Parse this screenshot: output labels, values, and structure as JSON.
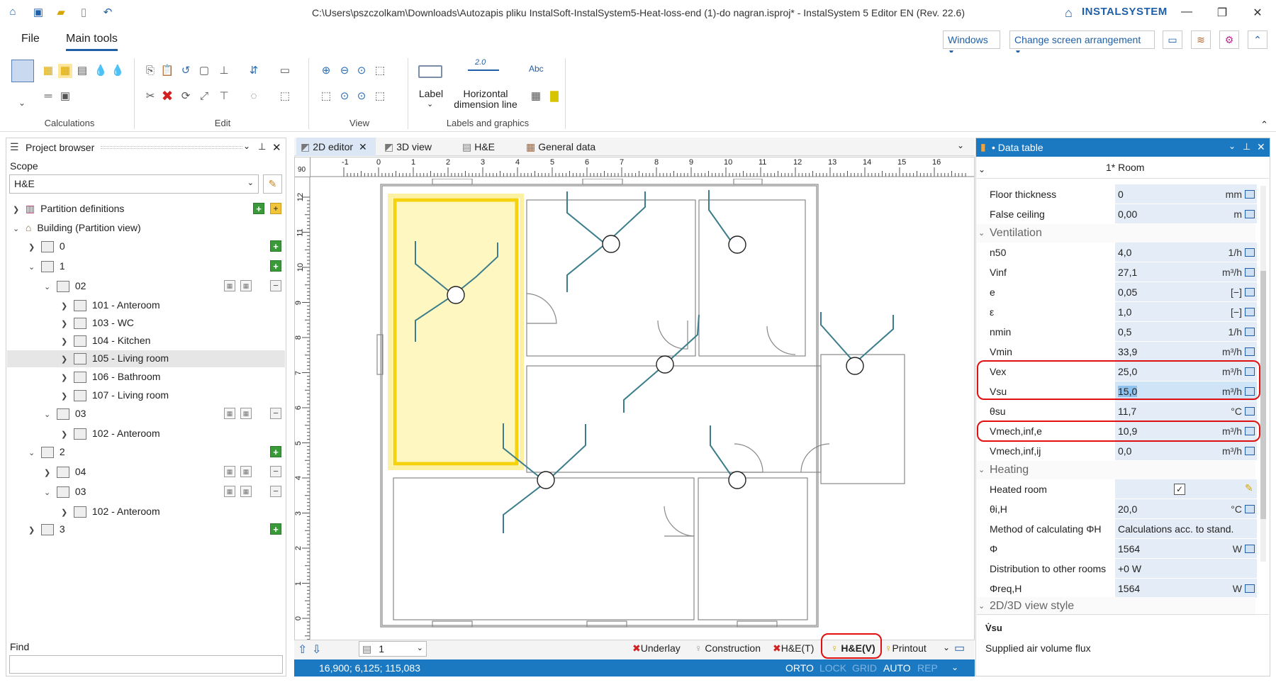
{
  "titlebar": {
    "title": "C:\\Users\\pszczolkam\\Downloads\\Autozapis pliku InstalSoft-InstalSystem5-Heat-loss-end (1)-do nagran.isproj* - InstalSystem 5 Editor EN (Rev. 22.6)",
    "brand": "INSTALSYSTEM"
  },
  "menu": {
    "file": "File",
    "main_tools": "Main tools",
    "windows": "Windows",
    "change_arrangement": "Change screen arrangement"
  },
  "ribbon": {
    "groups": {
      "calculations": "Calculations",
      "edit": "Edit",
      "view": "View",
      "labels": "Labels and graphics"
    },
    "label_btn": "Label",
    "hdim_btn_1": "Horizontal",
    "hdim_btn_2": "dimension line",
    "hdim_value": "2.0",
    "abc": "Abc"
  },
  "project_browser": {
    "title": "Project browser",
    "scope_label": "Scope",
    "scope_value": "H&E",
    "find_label": "Find",
    "tree": [
      {
        "label": "Partition definitions"
      },
      {
        "label": "Building (Partition view)"
      },
      {
        "label": "0"
      },
      {
        "label": "1"
      },
      {
        "label": "02"
      },
      {
        "label": "101 - Anteroom"
      },
      {
        "label": "103 - WC"
      },
      {
        "label": "104 - Kitchen"
      },
      {
        "label": "105 - Living room"
      },
      {
        "label": "106 - Bathroom"
      },
      {
        "label": "107 - Living room"
      },
      {
        "label": "03"
      },
      {
        "label": "102 - Anteroom"
      },
      {
        "label": "2"
      },
      {
        "label": "04"
      },
      {
        "label": "03"
      },
      {
        "label": "102 - Anteroom"
      },
      {
        "label": "3"
      }
    ]
  },
  "editor": {
    "tabs": [
      "2D editor",
      "3D view",
      "H&E",
      "General data"
    ],
    "ruler_x": [
      "-1",
      "0",
      "1",
      "2",
      "3",
      "4",
      "5",
      "6",
      "7",
      "8",
      "9",
      "10",
      "11",
      "12",
      "13",
      "14",
      "15",
      "16"
    ],
    "ruler_y": [
      "12",
      "11",
      "10",
      "9",
      "8",
      "7",
      "6",
      "5",
      "4",
      "3",
      "2",
      "1",
      "0"
    ],
    "corner": "90",
    "level": "1",
    "layers": [
      "Underlay",
      "Construction",
      "H&E(T)",
      "H&E(V)",
      "Printout"
    ],
    "coords": "16,900; 6,125; 115,083",
    "modes": [
      "ORTO",
      "LOCK",
      "GRID",
      "AUTO",
      "REP"
    ]
  },
  "data_table": {
    "title": "• Data table",
    "object": "1* Room",
    "rows1": [
      {
        "name": "Floor thickness",
        "value": "0",
        "unit": "mm"
      },
      {
        "name": "False ceiling",
        "value": "0,00",
        "unit": "m"
      }
    ],
    "sec_vent": "Ventilation",
    "rows_vent": [
      {
        "name": "n50",
        "value": "4,0",
        "unit": "1/h"
      },
      {
        "name": "Vinf",
        "value": "27,1",
        "unit": "m³/h"
      },
      {
        "name": "e",
        "value": "0,05",
        "unit": "[−]"
      },
      {
        "name": "ε",
        "value": "1,0",
        "unit": "[−]"
      },
      {
        "name": "nmin",
        "value": "0,5",
        "unit": "1/h"
      },
      {
        "name": "Vmin",
        "value": "33,9",
        "unit": "m³/h"
      },
      {
        "name": "Vex",
        "value": "25,0",
        "unit": "m³/h"
      },
      {
        "name": "Vsu",
        "value": "15,0",
        "unit": "m³/h"
      },
      {
        "name": "θsu",
        "value": "11,7",
        "unit": "°C"
      },
      {
        "name": "Vmech,inf,e",
        "value": "10,9",
        "unit": "m³/h"
      },
      {
        "name": "Vmech,inf,ij",
        "value": "0,0",
        "unit": "m³/h"
      }
    ],
    "sec_heat": "Heating",
    "rows_heat": [
      {
        "name": "Heated room",
        "value": "",
        "unit": ""
      },
      {
        "name": "θi,H",
        "value": "20,0",
        "unit": "°C"
      },
      {
        "name": "Method of calculating ΦH",
        "value": "Calculations acc. to stand.",
        "unit": ""
      },
      {
        "name": "Φ",
        "value": "1564",
        "unit": "W"
      },
      {
        "name": "Distribution to other rooms",
        "value": "+0 W",
        "unit": ""
      },
      {
        "name": "Φreq,H",
        "value": "1564",
        "unit": "W"
      }
    ],
    "sec_style": "2D/3D view style",
    "desc_symbol": "V̇su",
    "desc_text": "Supplied air volume flux"
  }
}
